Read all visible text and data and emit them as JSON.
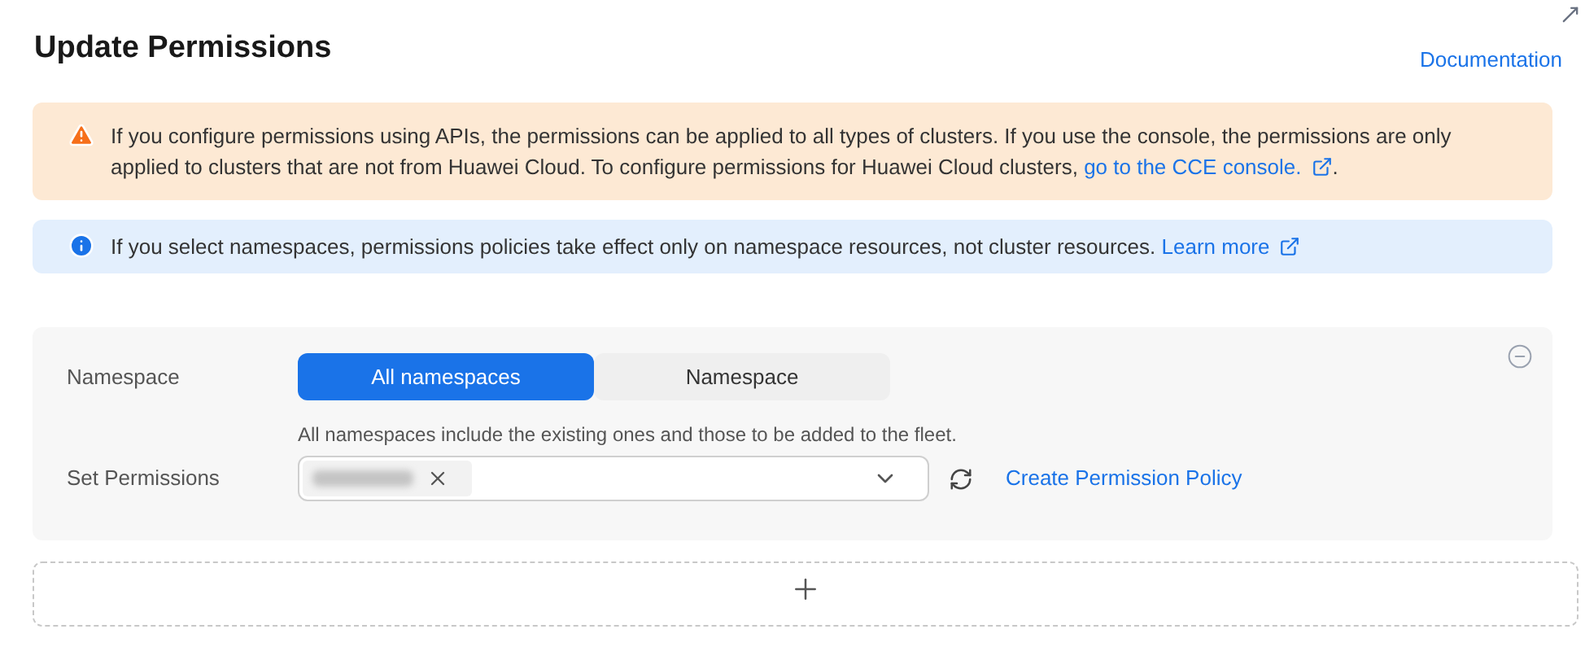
{
  "dialog": {
    "title": "Update Permissions",
    "documentation_link": "Documentation"
  },
  "warning": {
    "text": "If you configure permissions using APIs, the permissions can be applied to all types of clusters. If you use the console, the permissions are only applied to clusters that are not from Huawei Cloud. To configure permissions for Huawei Cloud clusters,",
    "link": "go to the CCE console.",
    "suffix": "."
  },
  "info": {
    "text": "If you select namespaces, permissions policies take effect only on namespace resources, not cluster resources.",
    "link": "Learn more"
  },
  "rule": {
    "namespace_label": "Namespace",
    "namespace_options": [
      {
        "label": "All namespaces",
        "selected": true
      },
      {
        "label": "Namespace",
        "selected": false
      }
    ],
    "namespace_hint": "All namespaces include the existing ones and those to be added to the fleet.",
    "permissions_label": "Set Permissions",
    "tags": [
      {
        "kind": "redacted"
      }
    ],
    "create_link": "Create Permission Policy"
  }
}
